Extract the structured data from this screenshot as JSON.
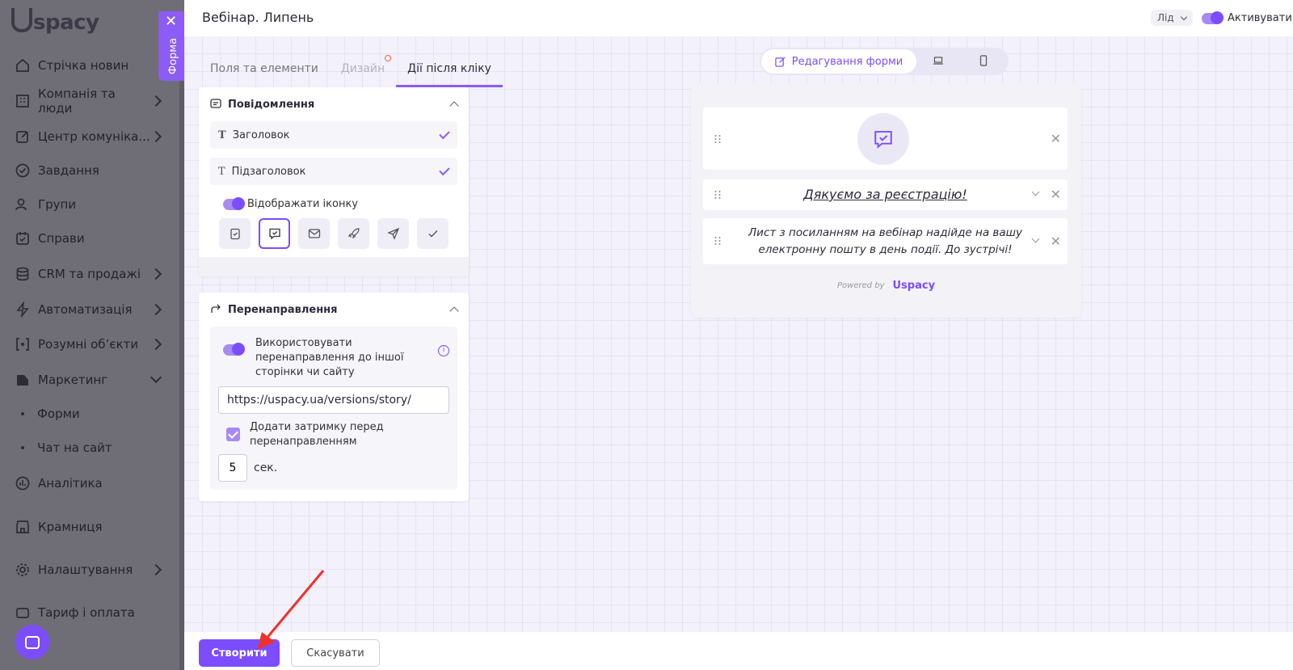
{
  "sidebar": {
    "logo": "spacy",
    "items": [
      {
        "label": "Стрічка новин"
      },
      {
        "label": "Компанія та люди"
      },
      {
        "label": "Центр комуніка..."
      },
      {
        "label": "Завдання"
      },
      {
        "label": "Групи"
      },
      {
        "label": "Справи"
      },
      {
        "label": "CRM та продажі"
      },
      {
        "label": "Автоматизація"
      },
      {
        "label": "Розумні об’єкти"
      },
      {
        "label": "Маркетинг"
      },
      {
        "label": "Аналітика"
      },
      {
        "label": "Крамниця"
      },
      {
        "label": "Налаштування"
      },
      {
        "label": "Тариф і оплата"
      }
    ],
    "sub_items": [
      {
        "label": "Форми"
      },
      {
        "label": "Чат на сайт"
      }
    ],
    "form_tab": "Форма"
  },
  "header": {
    "title": "Вебінар. Липень",
    "lead_select": "Лід",
    "activate_label": "Активувати"
  },
  "tabs": [
    {
      "label": "Поля та елементи"
    },
    {
      "label": "Дизайн"
    },
    {
      "label": "Дії після кліку"
    }
  ],
  "message_card": {
    "title": "Повідомлення",
    "fields": [
      {
        "label": "Заголовок"
      },
      {
        "label": "Підзаголовок"
      }
    ],
    "show_icon_label": "Відображати іконку"
  },
  "redirect_card": {
    "title": "Перенаправлення",
    "use_redirect_label": "Використовувати перенаправлення до іншої сторінки чи сайту",
    "url_value": "https://uspacy.ua/versions/story/",
    "delay_label": "Додати затримку перед перенаправленням",
    "delay_value": "5",
    "delay_unit": "сек."
  },
  "mode_switch": {
    "edit_label": "Редагування форми"
  },
  "preview": {
    "thanks_text": "Дякуємо за реєстрацію!",
    "letter_text": "Лист з посиланням на вебінар надійде на вашу електронну пошту в день події. До зустрічі!",
    "powered_by": "Powered by",
    "brand": "spacy"
  },
  "footer": {
    "create_label": "Створити",
    "cancel_label": "Скасувати"
  },
  "colors": {
    "accent": "#7c4dff",
    "sidebar_overlay": "#6f6e76"
  }
}
